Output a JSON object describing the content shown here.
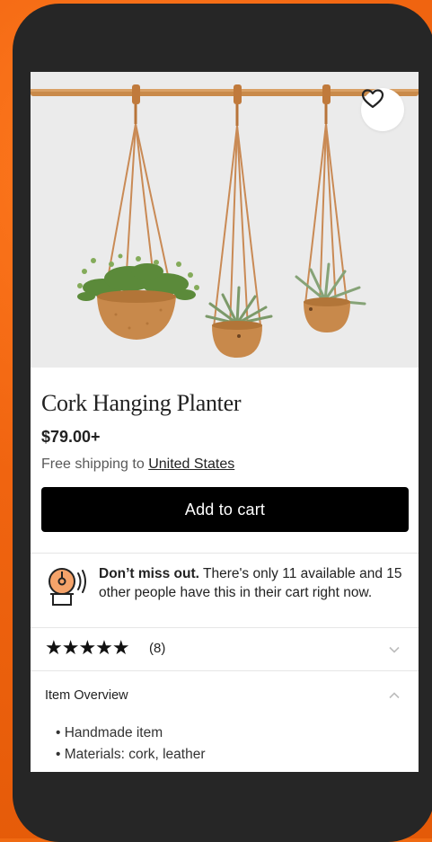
{
  "product": {
    "title": "Cork Hanging Planter",
    "price": "$79.00+",
    "shipping_prefix": "Free shipping to ",
    "shipping_country": "United States"
  },
  "actions": {
    "add_to_cart": "Add to cart",
    "favorite_icon": "heart-outline-icon"
  },
  "scarcity": {
    "icon": "alarm-bell-icon",
    "headline": "Don’t miss out.",
    "body": " There's only 11 available and 15 other people have this in their cart right now."
  },
  "reviews": {
    "rating": 5,
    "stars": "★★★★★",
    "count": "(8)"
  },
  "overview": {
    "title": "Item Overview",
    "items": [
      "• Handmade item",
      "• Materials: cork, leather"
    ]
  },
  "colors": {
    "background": "#f06a12",
    "device": "#262626",
    "button": "#000000",
    "bell_accent": "#f5a36a"
  }
}
